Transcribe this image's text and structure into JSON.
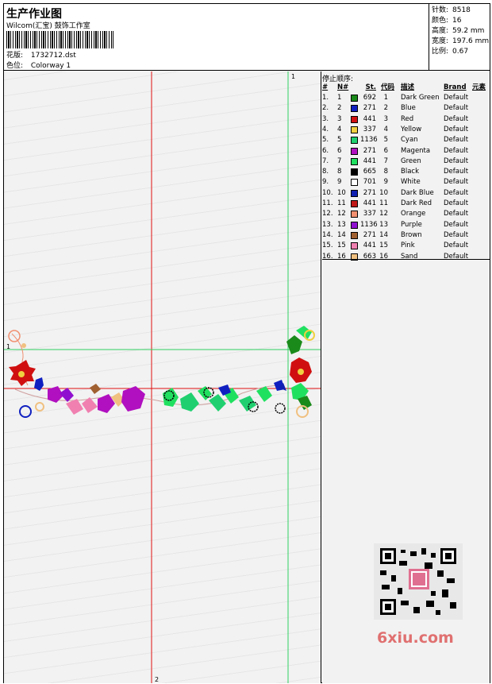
{
  "header": {
    "title": "生产作业图",
    "company": "Wilcom(汇宝) 鼓饰工作室",
    "design_label": "花版:",
    "design_value": "1732712.dst",
    "colorway_label": "色位:",
    "colorway_value": "Colorway 1"
  },
  "stats": [
    {
      "label": "针数:",
      "value": "8518"
    },
    {
      "label": "颜色:",
      "value": "16"
    },
    {
      "label": "高度:",
      "value": "59.2 mm"
    },
    {
      "label": "宽度:",
      "value": "197.6 mm"
    },
    {
      "label": "比例:",
      "value": "0.67"
    }
  ],
  "preview": {
    "marker_top": "1",
    "marker_left": "1",
    "marker_bottom": "2"
  },
  "stop_sequence": {
    "title": "停止顺序:",
    "columns": [
      "#",
      "N#",
      "St.",
      "代码",
      "描述",
      "Brand",
      "元素"
    ],
    "rows": [
      {
        "num": "1.",
        "n": "1",
        "color": "#1a8a1a",
        "st": "692",
        "code": "1",
        "desc": "Dark Green",
        "brand": "Default"
      },
      {
        "num": "2.",
        "n": "2",
        "color": "#1020c0",
        "st": "271",
        "code": "2",
        "desc": "Blue",
        "brand": "Default"
      },
      {
        "num": "3.",
        "n": "3",
        "color": "#d01010",
        "st": "441",
        "code": "3",
        "desc": "Red",
        "brand": "Default"
      },
      {
        "num": "4.",
        "n": "4",
        "color": "#f0d040",
        "st": "337",
        "code": "4",
        "desc": "Yellow",
        "brand": "Default"
      },
      {
        "num": "5.",
        "n": "5",
        "color": "#20d070",
        "st": "1136",
        "code": "5",
        "desc": "Cyan",
        "brand": "Default"
      },
      {
        "num": "6.",
        "n": "6",
        "color": "#b010c0",
        "st": "271",
        "code": "6",
        "desc": "Magenta",
        "brand": "Default"
      },
      {
        "num": "7.",
        "n": "7",
        "color": "#20e060",
        "st": "441",
        "code": "7",
        "desc": "Green",
        "brand": "Default"
      },
      {
        "num": "8.",
        "n": "8",
        "color": "#000000",
        "st": "665",
        "code": "8",
        "desc": "Black",
        "brand": "Default"
      },
      {
        "num": "9.",
        "n": "9",
        "color": "#ffffff",
        "st": "701",
        "code": "9",
        "desc": "White",
        "brand": "Default"
      },
      {
        "num": "10.",
        "n": "10",
        "color": "#1020b0",
        "st": "271",
        "code": "10",
        "desc": "Dark Blue",
        "brand": "Default"
      },
      {
        "num": "11.",
        "n": "11",
        "color": "#c01818",
        "st": "441",
        "code": "11",
        "desc": "Dark Red",
        "brand": "Default"
      },
      {
        "num": "12.",
        "n": "12",
        "color": "#f09070",
        "st": "337",
        "code": "12",
        "desc": "Orange",
        "brand": "Default"
      },
      {
        "num": "13.",
        "n": "13",
        "color": "#9010d0",
        "st": "1136",
        "code": "13",
        "desc": "Purple",
        "brand": "Default"
      },
      {
        "num": "14.",
        "n": "14",
        "color": "#a06030",
        "st": "271",
        "code": "14",
        "desc": "Brown",
        "brand": "Default"
      },
      {
        "num": "15.",
        "n": "15",
        "color": "#f080b0",
        "st": "441",
        "code": "15",
        "desc": "Pink",
        "brand": "Default"
      },
      {
        "num": "16.",
        "n": "16",
        "color": "#f0c080",
        "st": "663",
        "code": "16",
        "desc": "Sand",
        "brand": "Default"
      }
    ]
  },
  "watermark": "6xiu.com"
}
